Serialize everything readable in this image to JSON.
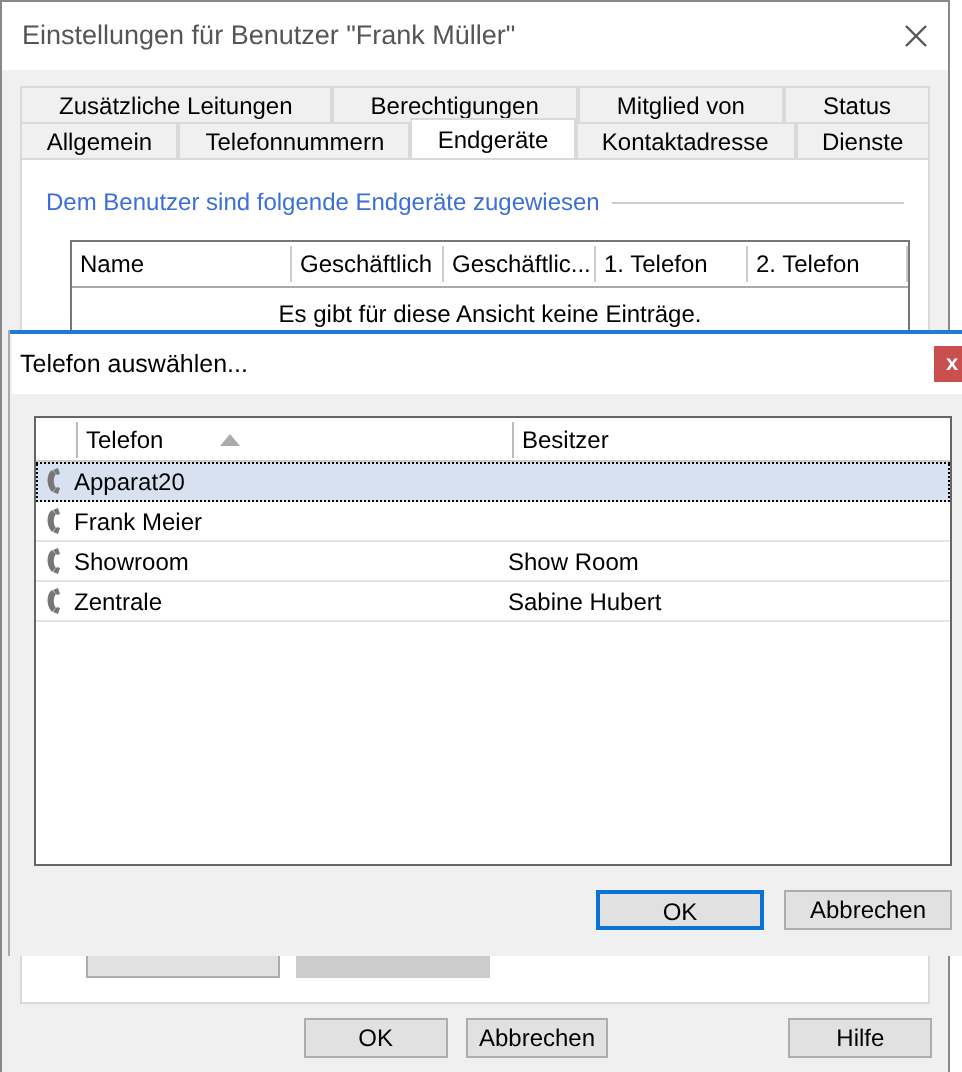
{
  "window": {
    "title": "Einstellungen für Benutzer \"Frank Müller\""
  },
  "tab_rows": [
    [
      {
        "label": "Zusätzliche Leitungen",
        "selected": false
      },
      {
        "label": "Berechtigungen",
        "selected": false
      },
      {
        "label": "Mitglied von",
        "selected": false
      },
      {
        "label": "Status",
        "selected": false
      }
    ],
    [
      {
        "label": "Allgemein",
        "selected": false
      },
      {
        "label": "Telefonnummern",
        "selected": false
      },
      {
        "label": "Endgeräte",
        "selected": true
      },
      {
        "label": "Kontaktadresse",
        "selected": false
      },
      {
        "label": "Dienste",
        "selected": false
      }
    ]
  ],
  "group": {
    "title": "Dem Benutzer sind folgende Endgeräte zugewiesen"
  },
  "table": {
    "columns": [
      "Name",
      "Geschäftlich",
      "Geschäftlic...",
      "1. Telefon",
      "2. Telefon"
    ],
    "empty_text": "Es gibt für diese Ansicht keine Einträge."
  },
  "buttons": [
    "OK",
    "Abbrechen",
    "Hilfe"
  ],
  "picker": {
    "title": "Telefon auswählen...",
    "close": "x",
    "columns": [
      "Telefon",
      "Besitzer"
    ],
    "rows": [
      {
        "telefon": "Apparat20",
        "besitzer": "",
        "selected": true
      },
      {
        "telefon": "Frank Meier",
        "besitzer": "",
        "selected": false
      },
      {
        "telefon": "Showroom",
        "besitzer": "Show Room",
        "selected": false
      },
      {
        "telefon": "Zentrale",
        "besitzer": "Sabine Hubert",
        "selected": false
      }
    ],
    "buttons": [
      {
        "label": "OK",
        "default": true
      },
      {
        "label": "Abbrechen",
        "default": false
      }
    ]
  }
}
